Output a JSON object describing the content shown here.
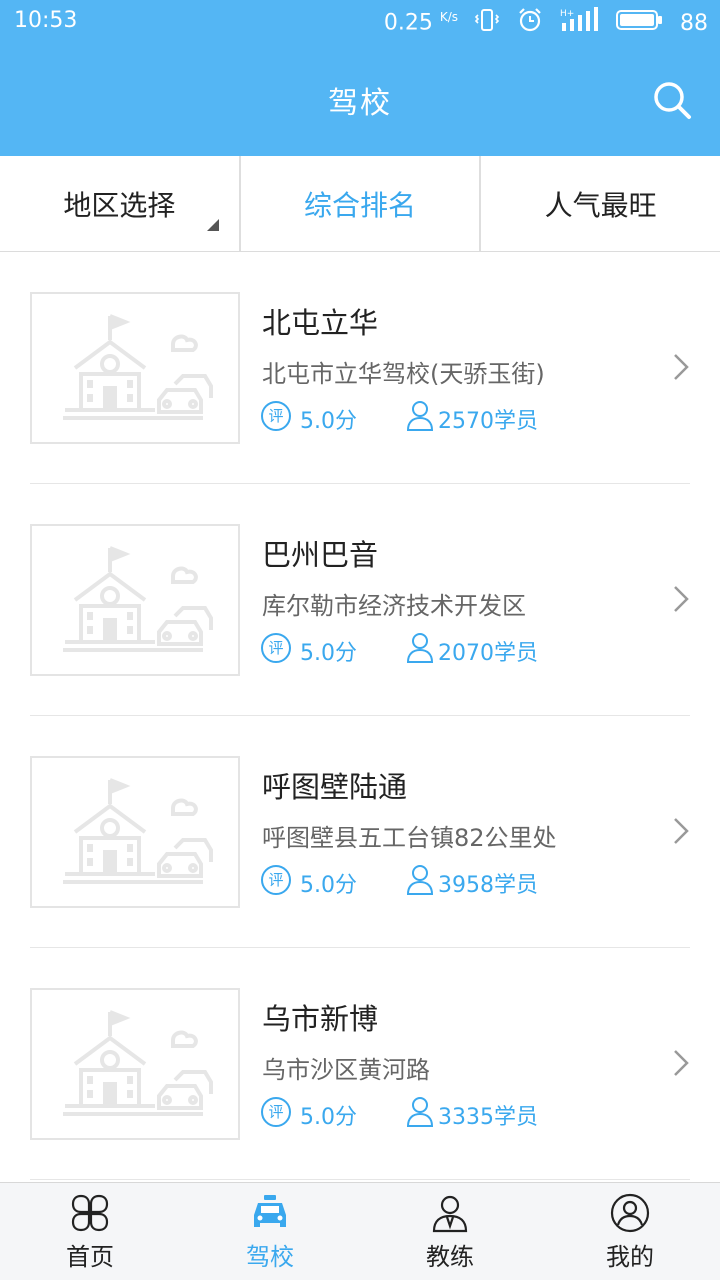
{
  "status_bar": {
    "time": "10:53",
    "net_speed": "0.25",
    "net_unit": "K/s",
    "battery": "88",
    "icons": [
      "vibrate-icon",
      "alarm-icon",
      "signal-icon",
      "battery-icon"
    ]
  },
  "header": {
    "title": "驾校",
    "search_icon": "search-icon"
  },
  "filters": [
    {
      "label": "地区选择",
      "active": false
    },
    {
      "label": "综合排名",
      "active": true
    },
    {
      "label": "人气最旺",
      "active": false
    }
  ],
  "schools": [
    {
      "name": "北屯立华",
      "address": "北屯市立华驾校(天骄玉街)",
      "rating_badge": "评",
      "rating": "5.0分",
      "students": "2570学员"
    },
    {
      "name": "巴州巴音",
      "address": "库尔勒市经济技术开发区",
      "rating_badge": "评",
      "rating": "5.0分",
      "students": "2070学员"
    },
    {
      "name": "呼图壁陆通",
      "address": "呼图壁县五工台镇82公里处",
      "rating_badge": "评",
      "rating": "5.0分",
      "students": "3958学员"
    },
    {
      "name": "乌市新博",
      "address": "乌市沙区黄河路",
      "rating_badge": "评",
      "rating": "5.0分",
      "students": "3335学员"
    }
  ],
  "bottom_nav": [
    {
      "label": "首页",
      "icon": "home-grid-icon",
      "active": false
    },
    {
      "label": "驾校",
      "icon": "car-icon",
      "active": true
    },
    {
      "label": "教练",
      "icon": "coach-icon",
      "active": false
    },
    {
      "label": "我的",
      "icon": "profile-icon",
      "active": false
    }
  ],
  "colors": {
    "primary": "#54b6f4",
    "accent": "#3aa8ee",
    "text": "#222222",
    "secondary_text": "#666666"
  }
}
